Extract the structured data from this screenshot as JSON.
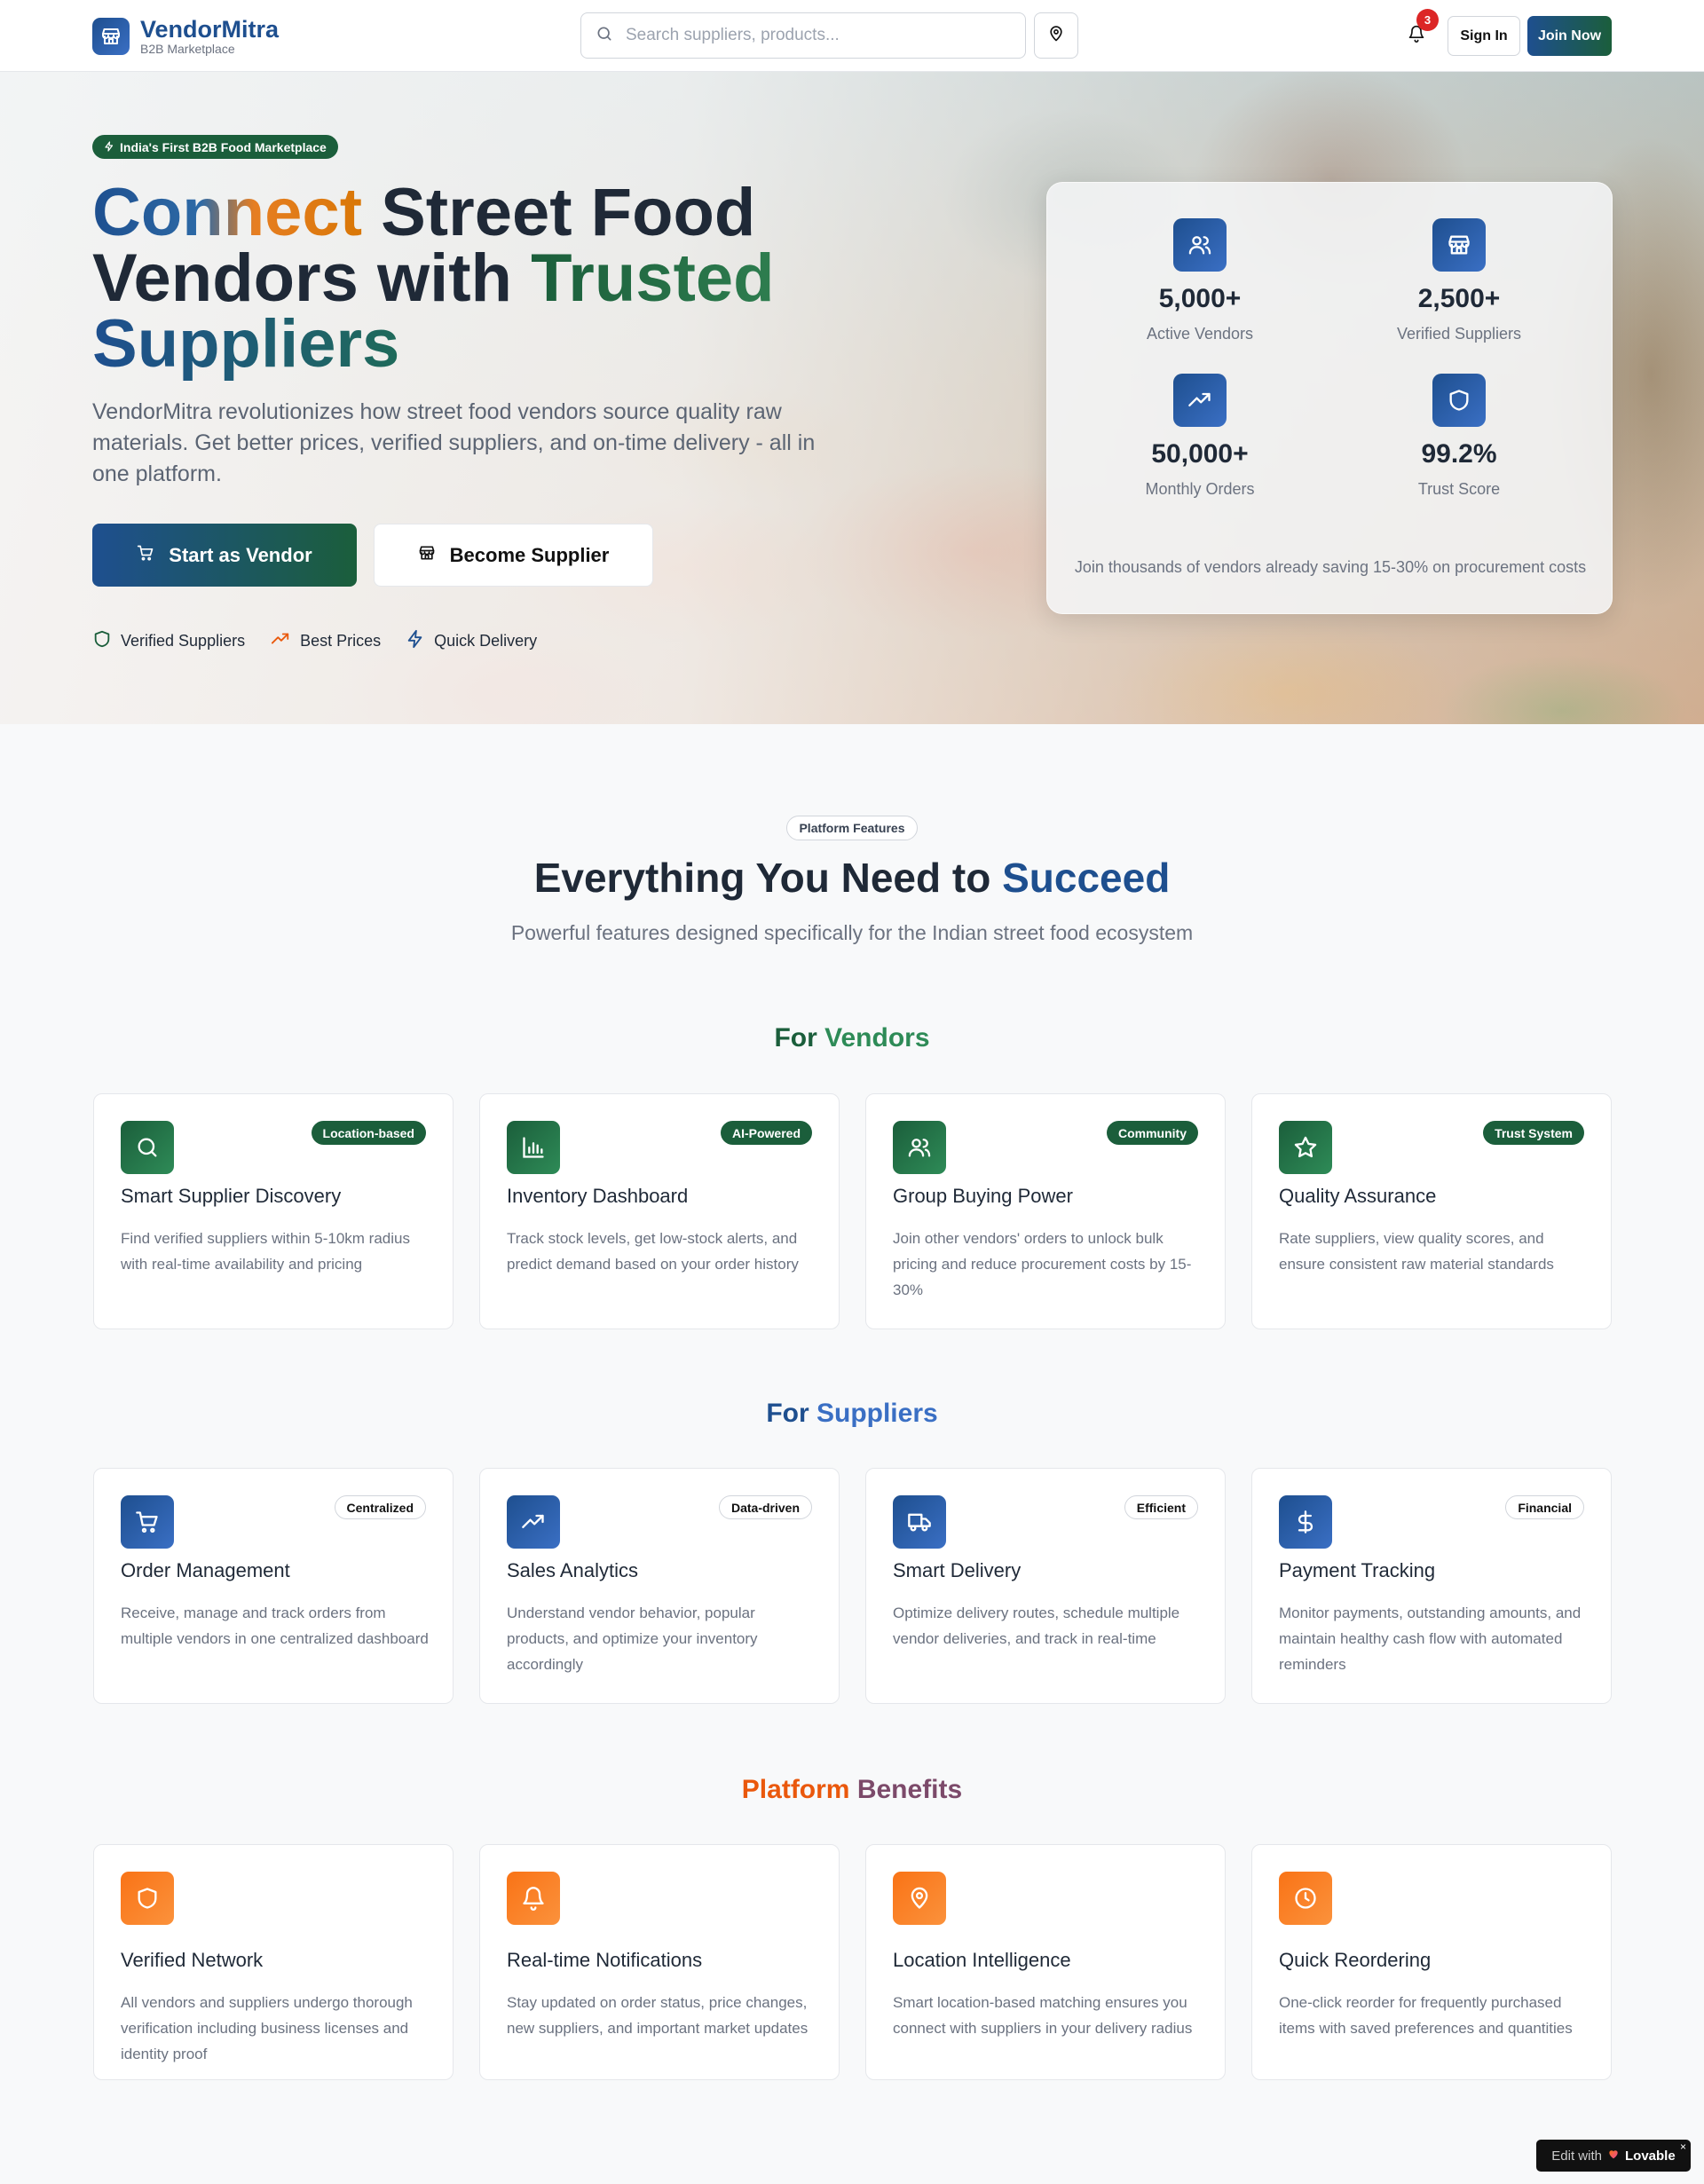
{
  "header": {
    "brand": "VendorMitra",
    "brand_sub": "B2B Marketplace",
    "search_placeholder": "Search suppliers, products...",
    "notifications_count": "3",
    "sign_in": "Sign In",
    "join_now": "Join Now"
  },
  "hero": {
    "pill": "India's First B2B Food Marketplace",
    "title_part1": "Connect",
    "title_part2": " Street Food Vendors with ",
    "title_part3": "Trusted",
    "title_part4": "Suppliers",
    "description": "VendorMitra revolutionizes how street food vendors source quality raw materials. Get better prices, verified suppliers, and on-time delivery - all in one platform.",
    "cta_vendor": "Start as Vendor",
    "cta_supplier": "Become Supplier",
    "trust": [
      {
        "label": "Verified Suppliers",
        "icon": "shield-icon"
      },
      {
        "label": "Best Prices",
        "icon": "trending-up-icon"
      },
      {
        "label": "Quick Delivery",
        "icon": "lightning-icon"
      }
    ],
    "stats": [
      {
        "value": "5,000+",
        "label": "Active Vendors",
        "icon": "users-icon"
      },
      {
        "value": "2,500+",
        "label": "Verified Suppliers",
        "icon": "store-icon"
      },
      {
        "value": "50,000+",
        "label": "Monthly Orders",
        "icon": "trending-up-icon"
      },
      {
        "value": "99.2%",
        "label": "Trust Score",
        "icon": "shield-icon"
      }
    ],
    "stats_footer": "Join thousands of vendors already saving 15-30% on procurement costs"
  },
  "features": {
    "tag": "Platform Features",
    "title_main": "Everything You Need to ",
    "title_accent": "Succeed",
    "subtitle": "Powerful features designed specifically for the Indian street food ecosystem",
    "groups": [
      {
        "title_a": "For ",
        "title_b": "Vendors",
        "cards": [
          {
            "badge": "Location-based",
            "title": "Smart Supplier Discovery",
            "desc": "Find verified suppliers within 5-10km radius with real-time availability and pricing",
            "icon": "search-icon"
          },
          {
            "badge": "AI-Powered",
            "title": "Inventory Dashboard",
            "desc": "Track stock levels, get low-stock alerts, and predict demand based on your order history",
            "icon": "bar-chart-icon"
          },
          {
            "badge": "Community",
            "title": "Group Buying Power",
            "desc": "Join other vendors' orders to unlock bulk pricing and reduce procurement costs by 15-30%",
            "icon": "users-icon"
          },
          {
            "badge": "Trust System",
            "title": "Quality Assurance",
            "desc": "Rate suppliers, view quality scores, and ensure consistent raw material standards",
            "icon": "star-icon"
          }
        ]
      },
      {
        "title_a": "For ",
        "title_b": "Suppliers",
        "cards": [
          {
            "badge": "Centralized",
            "title": "Order Management",
            "desc": "Receive, manage and track orders from multiple vendors in one centralized dashboard",
            "icon": "cart-icon"
          },
          {
            "badge": "Data-driven",
            "title": "Sales Analytics",
            "desc": "Understand vendor behavior, popular products, and optimize your inventory accordingly",
            "icon": "trending-up-icon"
          },
          {
            "badge": "Efficient",
            "title": "Smart Delivery",
            "desc": "Optimize delivery routes, schedule multiple vendor deliveries, and track in real-time",
            "icon": "truck-icon"
          },
          {
            "badge": "Financial",
            "title": "Payment Tracking",
            "desc": "Monitor payments, outstanding amounts, and maintain healthy cash flow with automated reminders",
            "icon": "dollar-icon"
          }
        ]
      },
      {
        "title_a": "Platform ",
        "title_b": "Benefits",
        "cards": [
          {
            "title": "Verified Network",
            "desc": "All vendors and suppliers undergo thorough verification including business licenses and identity proof",
            "icon": "shield-icon"
          },
          {
            "title": "Real-time Notifications",
            "desc": "Stay updated on order status, price changes, new suppliers, and important market updates",
            "icon": "bell-icon"
          },
          {
            "title": "Location Intelligence",
            "desc": "Smart location-based matching ensures you connect with suppliers in your delivery radius",
            "icon": "map-pin-icon"
          },
          {
            "title": "Quick Reordering",
            "desc": "One-click reorder for frequently purchased items with saved preferences and quantities",
            "icon": "clock-icon"
          }
        ]
      }
    ]
  },
  "lovable": {
    "edit": "Edit with",
    "brand": "Lovable",
    "close": "×"
  }
}
